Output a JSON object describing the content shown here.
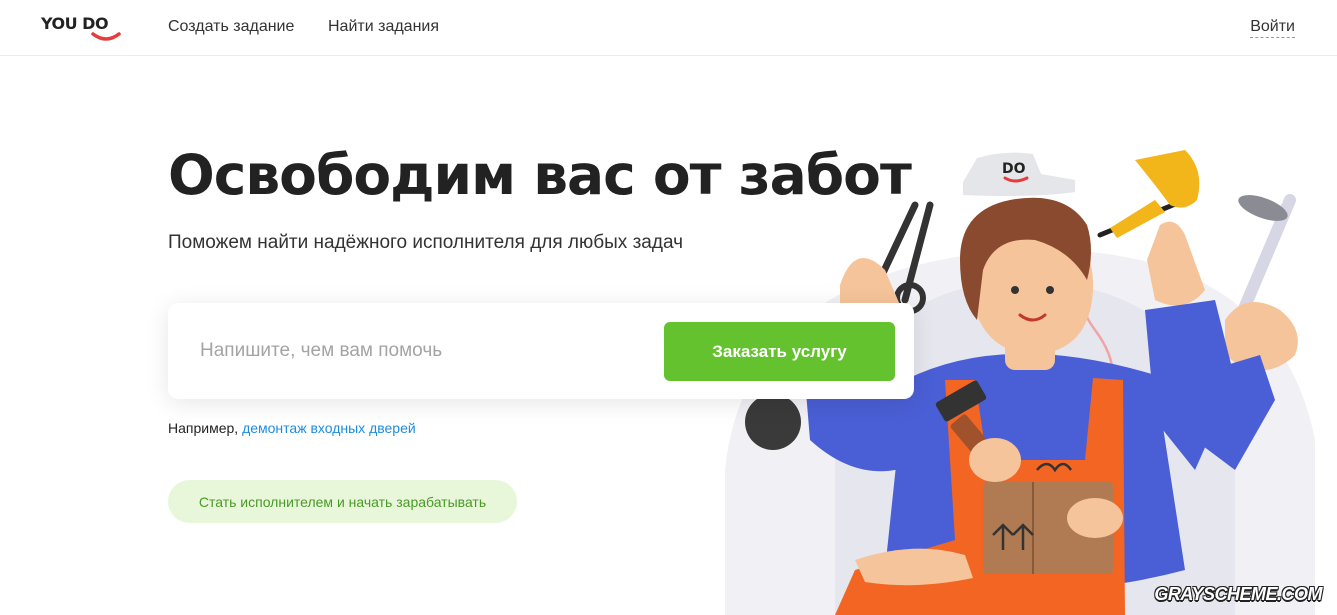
{
  "brand": {
    "logo_text": "YOU DO",
    "accent_color": "#e63c3c"
  },
  "nav": {
    "create_task": "Создать задание",
    "find_tasks": "Найти задания",
    "login": "Войти"
  },
  "hero": {
    "title": "Освободим вас от забот",
    "subtitle": "Поможем найти надёжного исполнителя для любых задач"
  },
  "search": {
    "value": "",
    "placeholder": "Напишите, чем вам помочь",
    "button_label": "Заказать услугу",
    "button_color": "#64c22e"
  },
  "example": {
    "prefix": "Например,",
    "link_text": "демонтаж входных дверей"
  },
  "become_performer": {
    "label": "Стать исполнителем и начать зарабатывать"
  },
  "illustration": {
    "cap_text": "DO"
  },
  "watermark": "GRAYSCHEME.COM"
}
